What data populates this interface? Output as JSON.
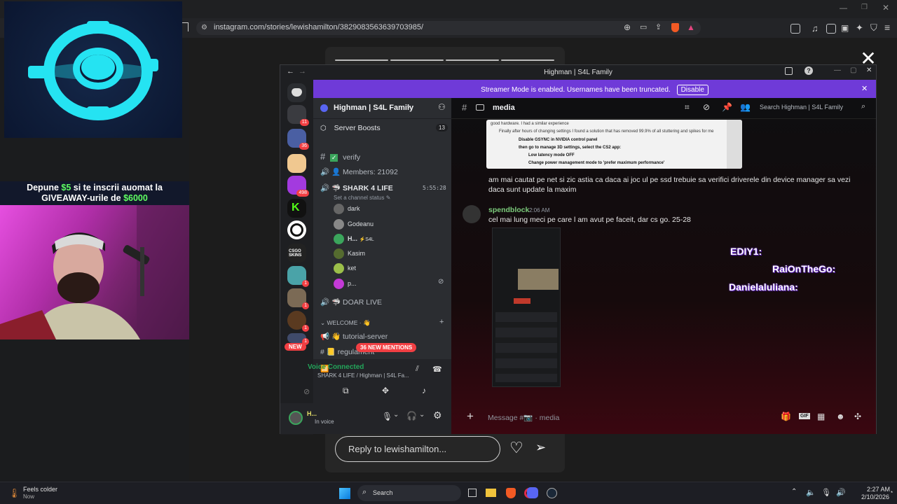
{
  "browser": {
    "url": "instagram.com/stories/lewishamilton/3829083563639703985/"
  },
  "story": {
    "reply_placeholder": "Reply to lewishamilton...",
    "close_glyph": "✕"
  },
  "promo": {
    "line1_pre": "Depune ",
    "line1_amount": "$5",
    "line1_post": " si te inscrii auomat la",
    "line2_pre": "GIVEAWAY-urile de ",
    "line2_amount": "$6000"
  },
  "discord": {
    "window_title": "Highman | S4L Family",
    "banner_text": "Streamer Mode is enabled. Usernames have been truncated.",
    "banner_button": "Disable",
    "server_name": "Highman | S4L Family",
    "server_boosts_label": "Server Boosts",
    "server_boosts_count": "13",
    "channels": {
      "verify": "verify",
      "members": "Members: 21092",
      "shark_voice": "SHARK 4 LIFE",
      "shark_timer": "5:55:28",
      "set_status": "Set a channel status",
      "doar_live": "DOAR LIVE",
      "welcome_category": "WELCOME · 👋",
      "tutorial": "tutorial-server",
      "regulament": "regulament",
      "new_mentions": "36 NEW MENTIONS"
    },
    "voice_members": [
      "dark",
      "Godeanu",
      "H...",
      "Kasim",
      "ket",
      "p..."
    ],
    "voice_member_tag": "⚡S4L",
    "voice_panel": {
      "status": "Voice Connected",
      "location": "SHARK 4 LIFE / Highman | S4L Fa..."
    },
    "user_panel": {
      "name": "H...",
      "status": "In voice"
    },
    "server_badges": [
      "11",
      "36",
      "498",
      "1",
      "1",
      "1",
      "1"
    ],
    "new_badge": "NEW",
    "chat": {
      "channel": "media",
      "search_placeholder": "Search Highman | S4L Family",
      "embed_lines": [
        "good hardware. I had a similar experience",
        "Finally after hours of changing settings I found a solution that has removed 99.9% of all stuttering and spikes for me",
        "Disable GSYNC in NVIDIA control panel",
        "then go to manage 3D settings, select the CS2 app:",
        "Low latency mode OFF",
        "Change power management mode to 'prefer maximum performance'"
      ],
      "message_1": "am mai cautat pe net si zic astia ca daca ai joc ul pe ssd trebuie sa verifici driverele din device manager sa vezi daca sunt update la maxim",
      "author_2": "spendblock",
      "time_2": "2:06 AM",
      "message_2": "cel mai lung meci pe care l am avut pe faceit, dar cs go. 25-28",
      "composer_placeholder": "Message #📷 · media"
    },
    "overlay_names": [
      "EDIY1:",
      "RaiOnTheGo:",
      "Danielaluliana:"
    ]
  },
  "taskbar": {
    "weather_title": "Feels colder",
    "weather_sub": "Now",
    "search_label": "Search",
    "time": "2:27 AM",
    "date": "2/10/2026"
  },
  "colors": {
    "discord_blurple": "#5865f2",
    "streamer_banner": "#6f3ad8",
    "badge_red": "#f23f43",
    "logo_cyan": "#25e3f2"
  }
}
